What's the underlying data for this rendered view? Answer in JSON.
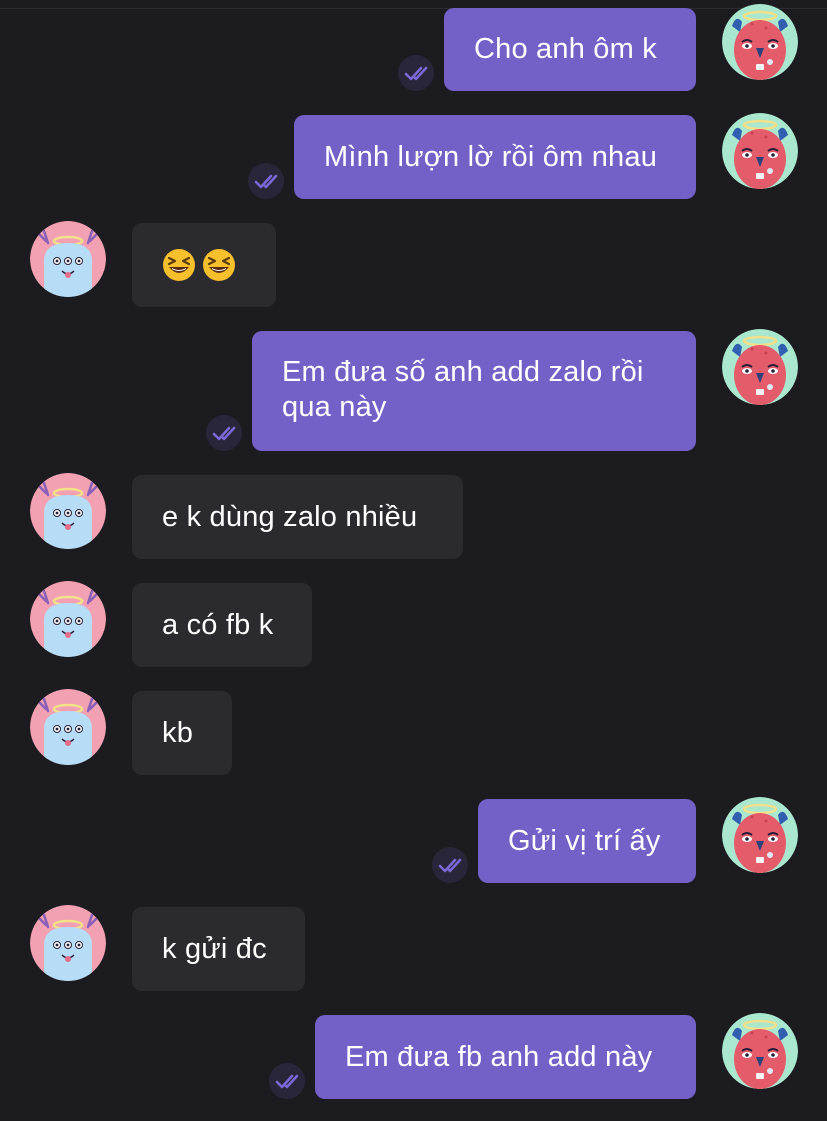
{
  "colors": {
    "background": "#1c1b20",
    "sent_bubble": "#7461c8",
    "received_bubble": "#2b2a2f",
    "read_check": "#7b67d6"
  },
  "messages": [
    {
      "sender": "me",
      "text": "Cho anh ôm k",
      "status_icon": "double-check-icon"
    },
    {
      "sender": "me",
      "text": "Mình lượn lờ rồi ôm nhau",
      "status_icon": "double-check-icon"
    },
    {
      "sender": "them",
      "text": "",
      "emojis": [
        "grinning-squinting-face",
        "grinning-squinting-face"
      ]
    },
    {
      "sender": "me",
      "text_lines": [
        "Em đưa số anh add zalo rồi",
        "qua này"
      ],
      "status_icon": "double-check-icon"
    },
    {
      "sender": "them",
      "text": "e k dùng zalo nhiều"
    },
    {
      "sender": "them",
      "text": "a có fb k"
    },
    {
      "sender": "them",
      "text": "kb"
    },
    {
      "sender": "me",
      "text": "Gửi vị trí ấy",
      "status_icon": "double-check-icon"
    },
    {
      "sender": "them",
      "text": "k gửi đc"
    },
    {
      "sender": "me",
      "text": "Em đưa fb anh add này",
      "status_icon": "double-check-icon"
    }
  ]
}
